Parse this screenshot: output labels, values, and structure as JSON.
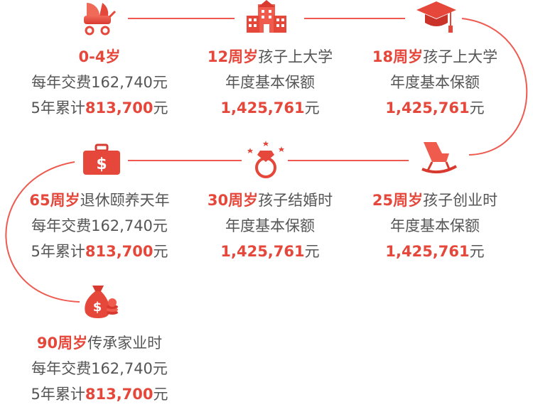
{
  "colors": {
    "accent": "#e5473b",
    "text": "#555555",
    "line": "#ee5a50"
  },
  "nodes": [
    {
      "id": "birth",
      "icon": "baby-stroller-icon",
      "age": "0-4岁",
      "desc": "",
      "line1_prefix": "每年交费162,740元",
      "line1_amt": "",
      "line1_suffix": "",
      "line2_prefix": "5年累计",
      "line2_amt": "813,700",
      "line2_suffix": "元"
    },
    {
      "id": "college12",
      "icon": "school-building-icon",
      "age": "12周岁",
      "desc": "孩子上大学",
      "line1_prefix": "年度基本保额",
      "line1_amt": "",
      "line1_suffix": "",
      "line2_prefix": "",
      "line2_amt": "1,425,761",
      "line2_suffix": "元"
    },
    {
      "id": "college18",
      "icon": "graduation-cap-icon",
      "age": "18周岁",
      "desc": "孩子上大学",
      "line1_prefix": "年度基本保额",
      "line1_amt": "",
      "line1_suffix": "",
      "line2_prefix": "",
      "line2_amt": "1,425,761",
      "line2_suffix": "元"
    },
    {
      "id": "startup25",
      "icon": "rocking-chair-icon",
      "age": "25周岁",
      "desc": "孩子创业时",
      "line1_prefix": "年度基本保额",
      "line1_amt": "",
      "line1_suffix": "",
      "line2_prefix": "",
      "line2_amt": "1,425,761",
      "line2_suffix": "元"
    },
    {
      "id": "marriage30",
      "icon": "diamond-ring-icon",
      "age": "30周岁",
      "desc": "孩子结婚时",
      "line1_prefix": "年度基本保额",
      "line1_amt": "",
      "line1_suffix": "",
      "line2_prefix": "",
      "line2_amt": "1,425,761",
      "line2_suffix": "元"
    },
    {
      "id": "retire65",
      "icon": "money-briefcase-icon",
      "age": "65周岁",
      "desc": "退休颐养天年",
      "line1_prefix": "每年交费162,740元",
      "line1_amt": "",
      "line1_suffix": "",
      "line2_prefix": "5年累计",
      "line2_amt": "813,700",
      "line2_suffix": "元"
    },
    {
      "id": "legacy90",
      "icon": "money-bag-icon",
      "age": "90周岁",
      "desc": "传承家业时",
      "line1_prefix": "每年交费162,740元",
      "line1_amt": "",
      "line1_suffix": "",
      "line2_prefix": "5年累计",
      "line2_amt": "813,700",
      "line2_suffix": "元"
    }
  ]
}
